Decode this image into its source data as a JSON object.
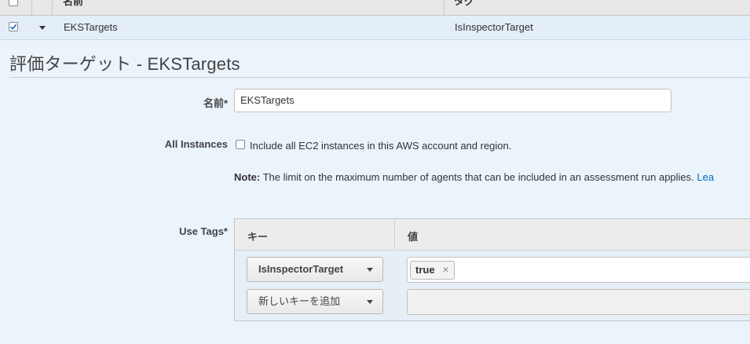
{
  "table": {
    "col_name_header": "名前",
    "col_tag_header": "タグ",
    "selected_row": {
      "name": "EKSTargets",
      "tag": "IsInspectorTarget",
      "checked": true
    }
  },
  "detail": {
    "title": "評価ターゲット - EKSTargets",
    "name_label": "名前*",
    "name_value": "EKSTargets",
    "all_instances_label": "All Instances",
    "all_instances_checkbox_text": "Include all EC2 instances in this AWS account and region.",
    "note_prefix": "Note:",
    "note_text": " The limit on the maximum number of agents that can be included in an assessment run applies. ",
    "note_link": "Lea",
    "use_tags_label": "Use Tags*",
    "tags": {
      "key_header": "キー",
      "value_header": "値",
      "rows": [
        {
          "key": "IsInspectorTarget",
          "value_token": "true",
          "remove_glyph": "×"
        }
      ],
      "new_key_placeholder": "新しいキーを追加"
    }
  },
  "colors": {
    "accent_link": "#0066c0",
    "selected_row": "#e3eef9",
    "page_bg": "#ebf3fb"
  }
}
